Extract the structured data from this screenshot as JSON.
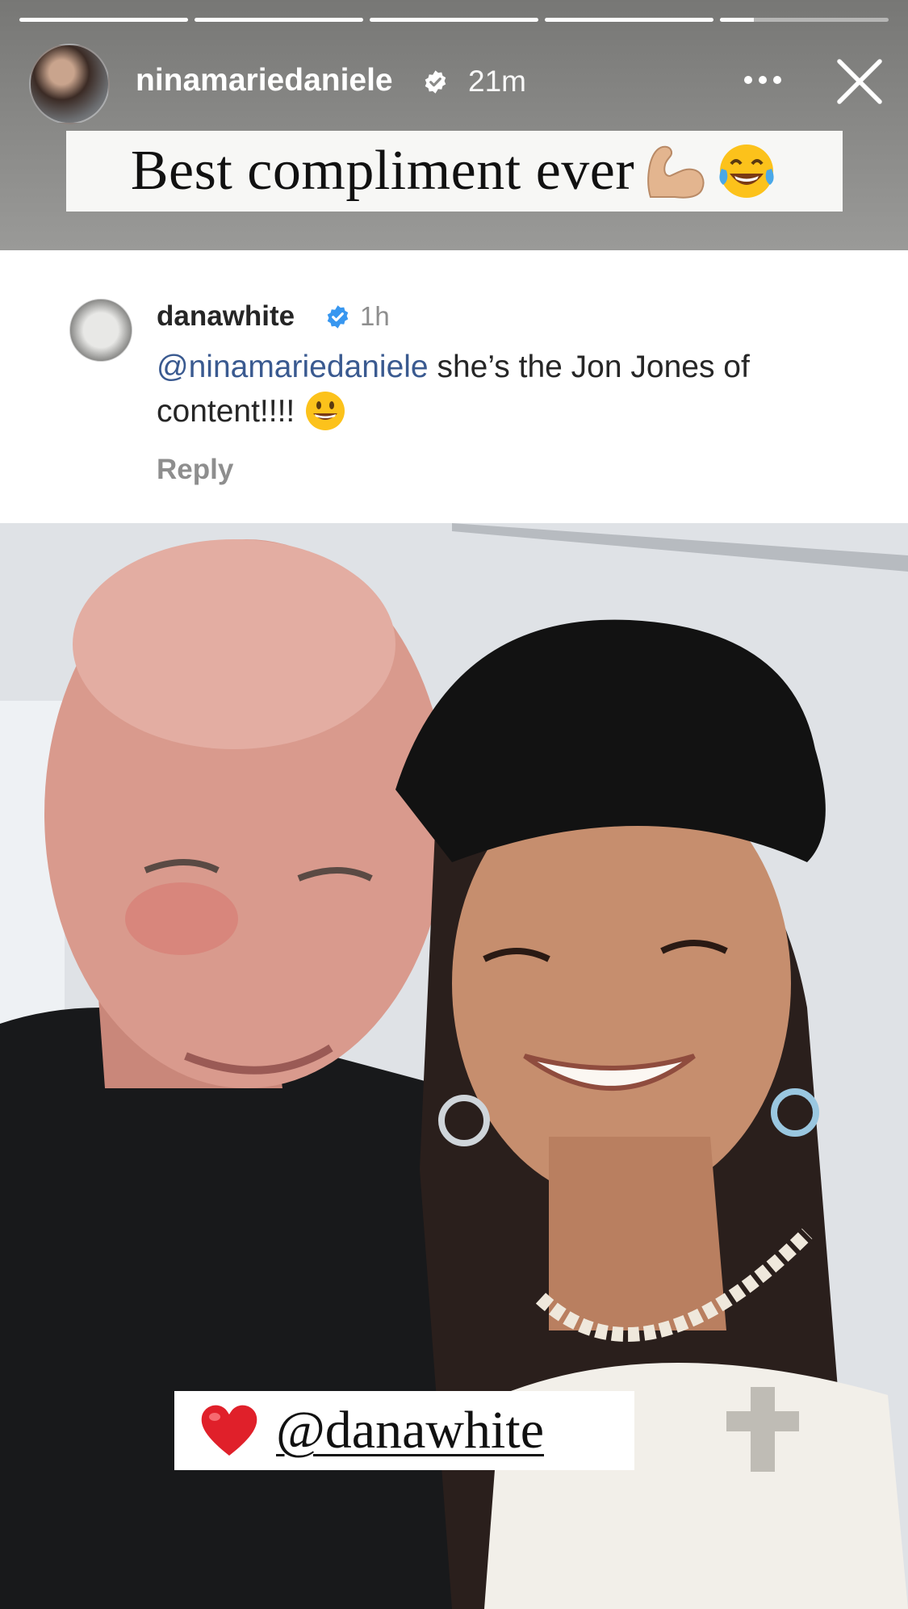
{
  "story": {
    "progress": [
      1,
      1,
      1,
      1,
      0.2
    ],
    "username": "ninamariedaniele",
    "time": "21m",
    "icons": {
      "avatar": "profile-photo",
      "verified": "verified-badge-icon",
      "more": "more-dots-icon",
      "close": "close-icon"
    }
  },
  "caption": {
    "text": "Best compliment ever",
    "emojis": [
      "flexed-biceps-icon",
      "tears-of-joy-icon"
    ]
  },
  "comment": {
    "username": "danawhite",
    "time": "1h",
    "mention": "@ninamariedaniele",
    "text": " she’s the Jon Jones of content!!!! ",
    "emoji": "grinning-face-icon",
    "reply_label": "Reply"
  },
  "mention_sticker": {
    "text": "@danawhite",
    "emoji": "red-heart-icon"
  },
  "colors": {
    "verified": "#3897f0",
    "mention": "#3a5a90",
    "heart": "#e0202a"
  }
}
